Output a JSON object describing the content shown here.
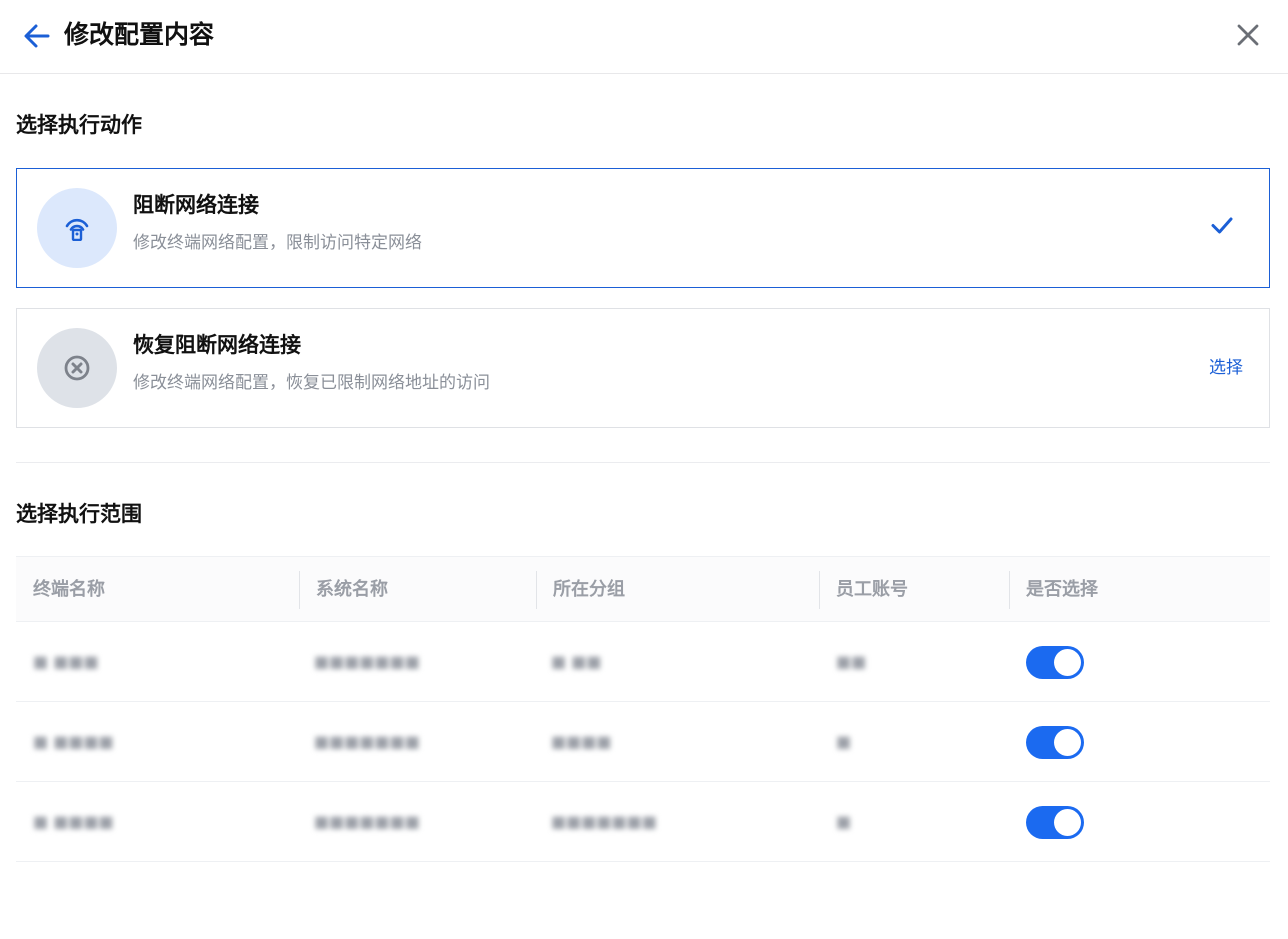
{
  "header": {
    "title": "修改配置内容",
    "back_icon": "arrow-left-icon",
    "close_icon": "close-icon"
  },
  "action_section": {
    "title": "选择执行动作",
    "options": [
      {
        "title": "阻断网络连接",
        "description": "修改终端网络配置，限制访问特定网络",
        "icon": "network-block-icon",
        "selected": true
      },
      {
        "title": "恢复阻断网络连接",
        "description": "修改终端网络配置，恢复已限制网络地址的访问",
        "icon": "close-circle-icon",
        "selected": false,
        "select_label": "选择"
      }
    ]
  },
  "scope_section": {
    "title": "选择执行范围",
    "columns": [
      "终端名称",
      "系统名称",
      "所在分组",
      "员工账号",
      "是否选择"
    ],
    "rows": [
      {
        "terminal": "■ ■■■",
        "system": "■■■■■■■",
        "group": "■ ■■",
        "account": "■■",
        "selected": true
      },
      {
        "terminal": "■ ■■■■",
        "system": "■■■■■■■",
        "group": "■■■■",
        "account": "■",
        "selected": true
      },
      {
        "terminal": "■ ■■■■",
        "system": "■■■■■■■",
        "group": "■■■■■■■",
        "account": "■",
        "selected": true
      }
    ]
  },
  "colors": {
    "accent": "#1b5fd6",
    "toggle_on": "#1b6af0",
    "muted_text": "#8a8f98"
  }
}
